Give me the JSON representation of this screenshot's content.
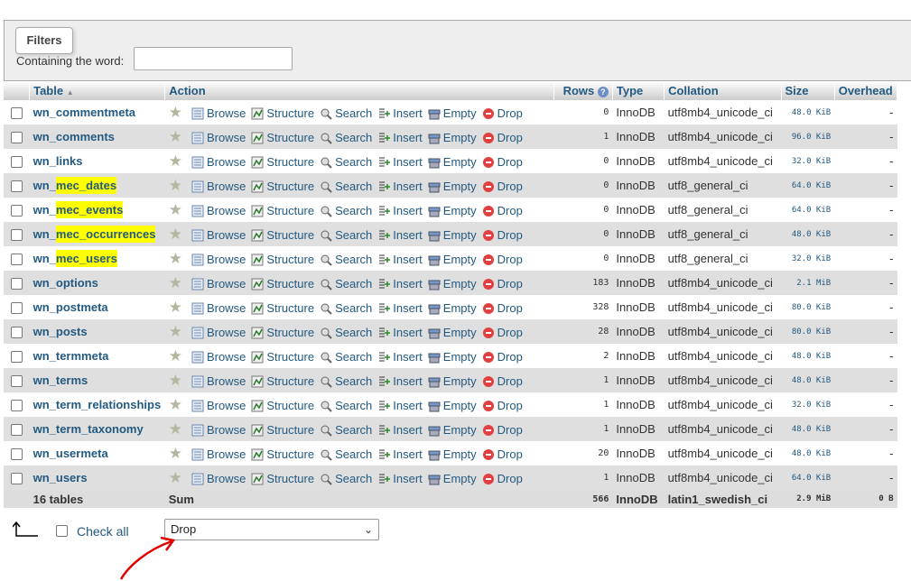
{
  "filters": {
    "legend": "Filters",
    "label": "Containing the word:",
    "value": ""
  },
  "headers": {
    "table": "Table",
    "sort_indicator": "▲",
    "action": "Action",
    "rows": "Rows",
    "type": "Type",
    "collation": "Collation",
    "size": "Size",
    "overhead": "Overhead"
  },
  "actions": {
    "browse": "Browse",
    "structure": "Structure",
    "search": "Search",
    "insert": "Insert",
    "empty": "Empty",
    "drop": "Drop"
  },
  "rows": [
    {
      "name": "wn_commentmeta",
      "rows": "0",
      "type": "InnoDB",
      "collation": "utf8mb4_unicode_ci",
      "size": "48.0 KiB",
      "overhead": "-"
    },
    {
      "name": "wn_comments",
      "rows": "1",
      "type": "InnoDB",
      "collation": "utf8mb4_unicode_ci",
      "size": "96.0 KiB",
      "overhead": "-"
    },
    {
      "name": "wn_links",
      "rows": "0",
      "type": "InnoDB",
      "collation": "utf8mb4_unicode_ci",
      "size": "32.0 KiB",
      "overhead": "-"
    },
    {
      "name": "wn_mec_dates",
      "rows": "0",
      "type": "InnoDB",
      "collation": "utf8_general_ci",
      "size": "64.0 KiB",
      "overhead": "-",
      "highlight": "mec_dates"
    },
    {
      "name": "wn_mec_events",
      "rows": "0",
      "type": "InnoDB",
      "collation": "utf8_general_ci",
      "size": "64.0 KiB",
      "overhead": "-",
      "highlight": "mec_events"
    },
    {
      "name": "wn_mec_occurrences",
      "rows": "0",
      "type": "InnoDB",
      "collation": "utf8_general_ci",
      "size": "48.0 KiB",
      "overhead": "-",
      "highlight": "mec_occurrences"
    },
    {
      "name": "wn_mec_users",
      "rows": "0",
      "type": "InnoDB",
      "collation": "utf8_general_ci",
      "size": "32.0 KiB",
      "overhead": "-",
      "highlight": "mec_users"
    },
    {
      "name": "wn_options",
      "rows": "183",
      "type": "InnoDB",
      "collation": "utf8mb4_unicode_ci",
      "size": "2.1 MiB",
      "overhead": "-"
    },
    {
      "name": "wn_postmeta",
      "rows": "328",
      "type": "InnoDB",
      "collation": "utf8mb4_unicode_ci",
      "size": "80.0 KiB",
      "overhead": "-"
    },
    {
      "name": "wn_posts",
      "rows": "28",
      "type": "InnoDB",
      "collation": "utf8mb4_unicode_ci",
      "size": "80.0 KiB",
      "overhead": "-"
    },
    {
      "name": "wn_termmeta",
      "rows": "2",
      "type": "InnoDB",
      "collation": "utf8mb4_unicode_ci",
      "size": "48.0 KiB",
      "overhead": "-"
    },
    {
      "name": "wn_terms",
      "rows": "1",
      "type": "InnoDB",
      "collation": "utf8mb4_unicode_ci",
      "size": "48.0 KiB",
      "overhead": "-"
    },
    {
      "name": "wn_term_relationships",
      "rows": "1",
      "type": "InnoDB",
      "collation": "utf8mb4_unicode_ci",
      "size": "32.0 KiB",
      "overhead": "-"
    },
    {
      "name": "wn_term_taxonomy",
      "rows": "1",
      "type": "InnoDB",
      "collation": "utf8mb4_unicode_ci",
      "size": "48.0 KiB",
      "overhead": "-"
    },
    {
      "name": "wn_usermeta",
      "rows": "20",
      "type": "InnoDB",
      "collation": "utf8mb4_unicode_ci",
      "size": "48.0 KiB",
      "overhead": "-"
    },
    {
      "name": "wn_users",
      "rows": "1",
      "type": "InnoDB",
      "collation": "utf8mb4_unicode_ci",
      "size": "64.0 KiB",
      "overhead": "-"
    }
  ],
  "summary": {
    "tables": "16 tables",
    "sum": "Sum",
    "rows": "566",
    "type": "InnoDB",
    "collation": "latin1_swedish_ci",
    "size": "2.9 MiB",
    "overhead": "0 B"
  },
  "footer": {
    "check_all": "Check all",
    "bulk_action": "Drop"
  },
  "colors": {
    "highlight": "#ffff00",
    "annotation_arrow": "#e00000",
    "link": "#235a81"
  }
}
